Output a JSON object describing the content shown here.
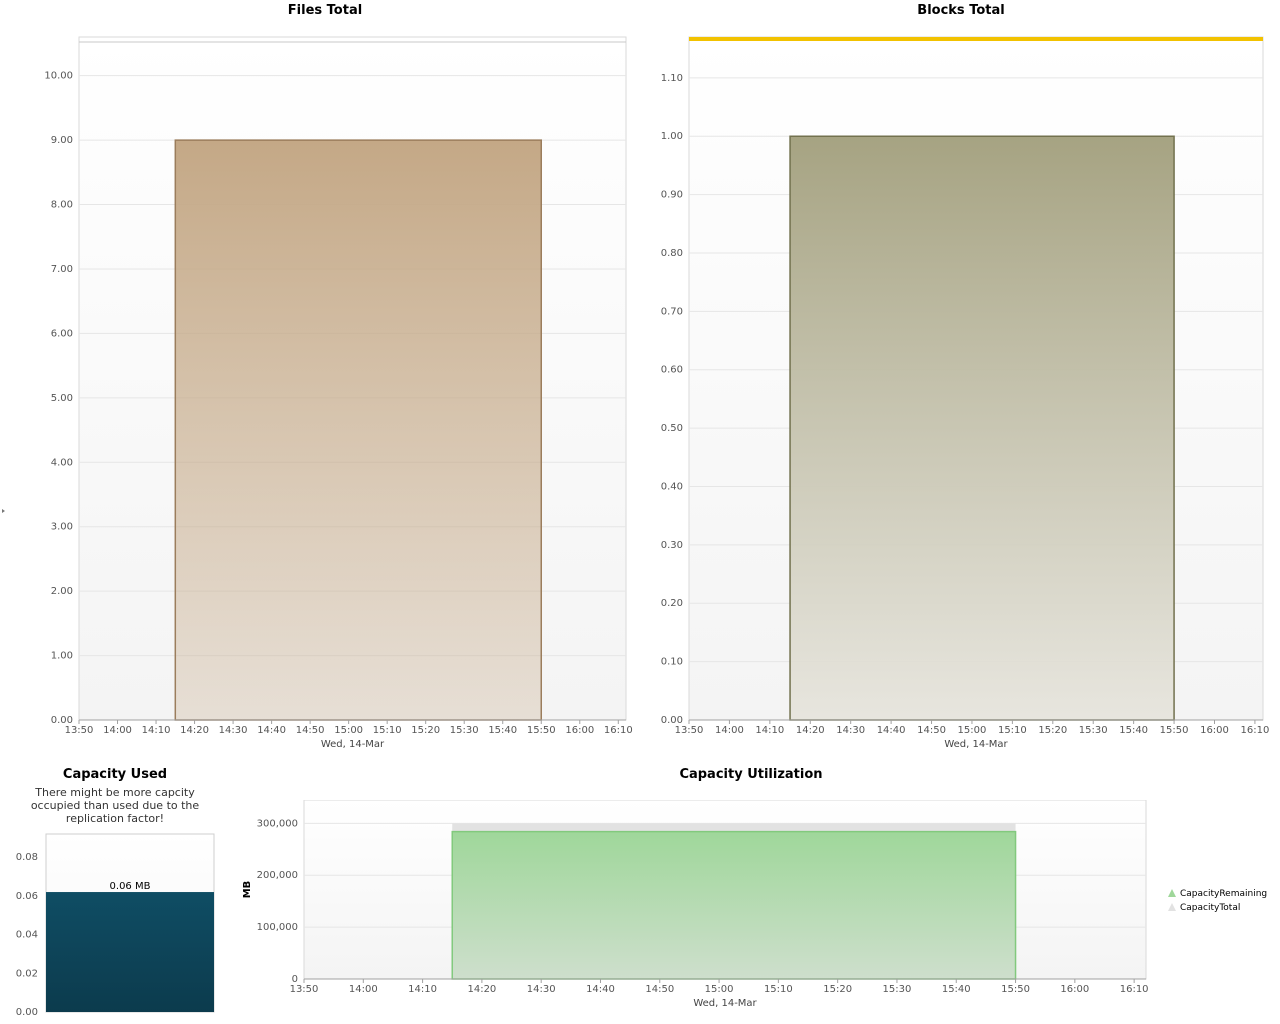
{
  "colors": {
    "files_fill": "#c4a886",
    "files_stroke": "#9b7d5c",
    "blocks_fill": "#a6a382",
    "blocks_stroke": "#72714e",
    "blocks_top_band": "#f2c200",
    "capacity_used_fill": "#0f4d64",
    "capacity_remaining_fill": "#9fd79a",
    "capacity_remaining_stroke": "#82c97d",
    "capacity_total_fill": "#e2e2e2",
    "grid": "#e6e6e6",
    "plot_bg": "#f4f4f4"
  },
  "chart_data": [
    {
      "type": "area",
      "title": "Files Total",
      "xlabel": "Wed, 14-Mar",
      "ylabel": "",
      "x_ticks": [
        "13:50",
        "14:00",
        "14:10",
        "14:20",
        "14:30",
        "14:40",
        "14:50",
        "15:00",
        "15:10",
        "15:20",
        "15:30",
        "15:40",
        "15:50",
        "16:00",
        "16:10"
      ],
      "y_ticks": [
        "0.00",
        "1.00",
        "2.00",
        "3.00",
        "4.00",
        "5.00",
        "6.00",
        "7.00",
        "8.00",
        "9.00",
        "10.00"
      ],
      "xlim": [
        "13:50",
        "16:12"
      ],
      "ylim": [
        0,
        10.6
      ],
      "grid": true,
      "series": [
        {
          "x": [
            "14:15",
            "15:50"
          ],
          "values": [
            9,
            9
          ]
        }
      ]
    },
    {
      "type": "area",
      "title": "Blocks Total",
      "xlabel": "Wed, 14-Mar",
      "ylabel": "",
      "x_ticks": [
        "13:50",
        "14:00",
        "14:10",
        "14:20",
        "14:30",
        "14:40",
        "14:50",
        "15:00",
        "15:10",
        "15:20",
        "15:30",
        "15:40",
        "15:50",
        "16:00",
        "16:10"
      ],
      "y_ticks": [
        "0.00",
        "0.10",
        "0.20",
        "0.30",
        "0.40",
        "0.50",
        "0.60",
        "0.70",
        "0.80",
        "0.90",
        "1.00",
        "1.10"
      ],
      "xlim": [
        "13:50",
        "16:12"
      ],
      "ylim": [
        0,
        1.17
      ],
      "grid": true,
      "series": [
        {
          "x": [
            "14:15",
            "15:50"
          ],
          "values": [
            1,
            1
          ]
        }
      ]
    },
    {
      "type": "bar",
      "title": "Capacity Used",
      "note": "There might be more capcity occupied than used due to the replication factor!",
      "y_ticks": [
        "0.00",
        "0.02",
        "0.04",
        "0.06",
        "0.08"
      ],
      "ylim": [
        0,
        0.092
      ],
      "grid": false,
      "values": [
        0.062
      ],
      "data_labels": [
        "0.06 MB"
      ]
    },
    {
      "type": "area",
      "title": "Capacity Utilization",
      "xlabel": "Wed, 14-Mar",
      "ylabel": "MB",
      "x_ticks": [
        "13:50",
        "14:00",
        "14:10",
        "14:20",
        "14:30",
        "14:40",
        "14:50",
        "15:00",
        "15:10",
        "15:20",
        "15:30",
        "15:40",
        "15:50",
        "16:00",
        "16:10"
      ],
      "y_ticks": [
        "0",
        "100,000",
        "200,000",
        "300,000"
      ],
      "xlim": [
        "13:50",
        "16:12"
      ],
      "ylim": [
        0,
        345000
      ],
      "grid": true,
      "legend": "right",
      "series": [
        {
          "name": "CapacityRemaining",
          "x": [
            "14:15",
            "15:50"
          ],
          "values": [
            284000,
            284000
          ]
        },
        {
          "name": "CapacityTotal",
          "x": [
            "14:15",
            "15:50"
          ],
          "values": [
            300000,
            300000
          ]
        }
      ]
    }
  ]
}
